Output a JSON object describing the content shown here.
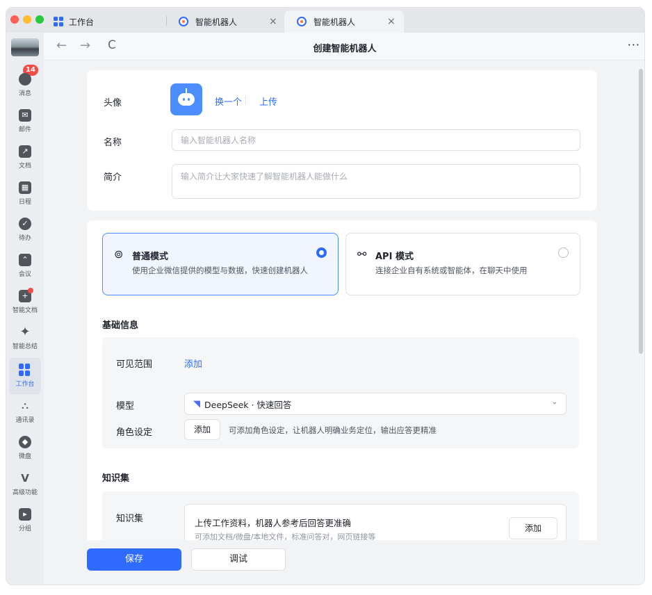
{
  "tabs": [
    {
      "label": "工作台",
      "icon": "grid-icon"
    },
    {
      "label": "智能机器人",
      "icon": "bot-icon",
      "close": "×"
    },
    {
      "label": "智能机器人",
      "icon": "bot-icon",
      "close": "×"
    }
  ],
  "nav": {
    "back": "←",
    "forward": "→",
    "refresh": "C",
    "title": "创建智能机器人",
    "more": "···"
  },
  "sidebar": {
    "badge_count": "14",
    "items": [
      {
        "label": "消息",
        "icon": "message-icon"
      },
      {
        "label": "邮件",
        "icon": "mail-icon"
      },
      {
        "label": "文档",
        "icon": "document-icon"
      },
      {
        "label": "日程",
        "icon": "calendar-icon"
      },
      {
        "label": "待办",
        "icon": "todo-icon"
      },
      {
        "label": "会议",
        "icon": "meeting-icon"
      },
      {
        "label": "智能文档",
        "icon": "smart-doc-icon"
      },
      {
        "label": "智能总结",
        "icon": "sparkle-icon"
      },
      {
        "label": "工作台",
        "icon": "workbench-icon"
      },
      {
        "label": "通讯录",
        "icon": "contacts-icon"
      },
      {
        "label": "微盘",
        "icon": "drive-icon"
      },
      {
        "label": "高级功能",
        "icon": "advanced-icon"
      },
      {
        "label": "分组",
        "icon": "group-icon"
      }
    ]
  },
  "profile": {
    "avatar_label": "头像",
    "change_link": "换一个",
    "upload_link": "上传",
    "name_label": "名称",
    "name_placeholder": "输入智能机器人名称",
    "intro_label": "简介",
    "intro_placeholder": "输入简介让大家快速了解智能机器人能做什么"
  },
  "modes": [
    {
      "title": "普通模式",
      "desc": "使用企业微信提供的模型与数据，快速创建机器人",
      "selected": true
    },
    {
      "title": "API 模式",
      "desc": "连接企业自有系统或智能体，在聊天中使用",
      "selected": false
    }
  ],
  "basic": {
    "section_title": "基础信息",
    "visibility_label": "可见范围",
    "visibility_add": "添加",
    "model_label": "模型",
    "model_value": "DeepSeek · 快速回答",
    "role_label": "角色设定",
    "role_add": "添加",
    "role_hint": "可添加角色设定，让机器人明确业务定位，输出应答更精准"
  },
  "knowledge": {
    "section_title": "知识集",
    "label": "知识集",
    "box_title": "上传工作资料，机器人参考后回答更准确",
    "box_sub": "可添加文档/微盘/本地文件，标准问答对，网页链接等",
    "add": "添加"
  },
  "footer": {
    "save": "保存",
    "debug": "调试"
  },
  "colors": {
    "accent": "#2f6bff",
    "badge": "#f54a45"
  }
}
